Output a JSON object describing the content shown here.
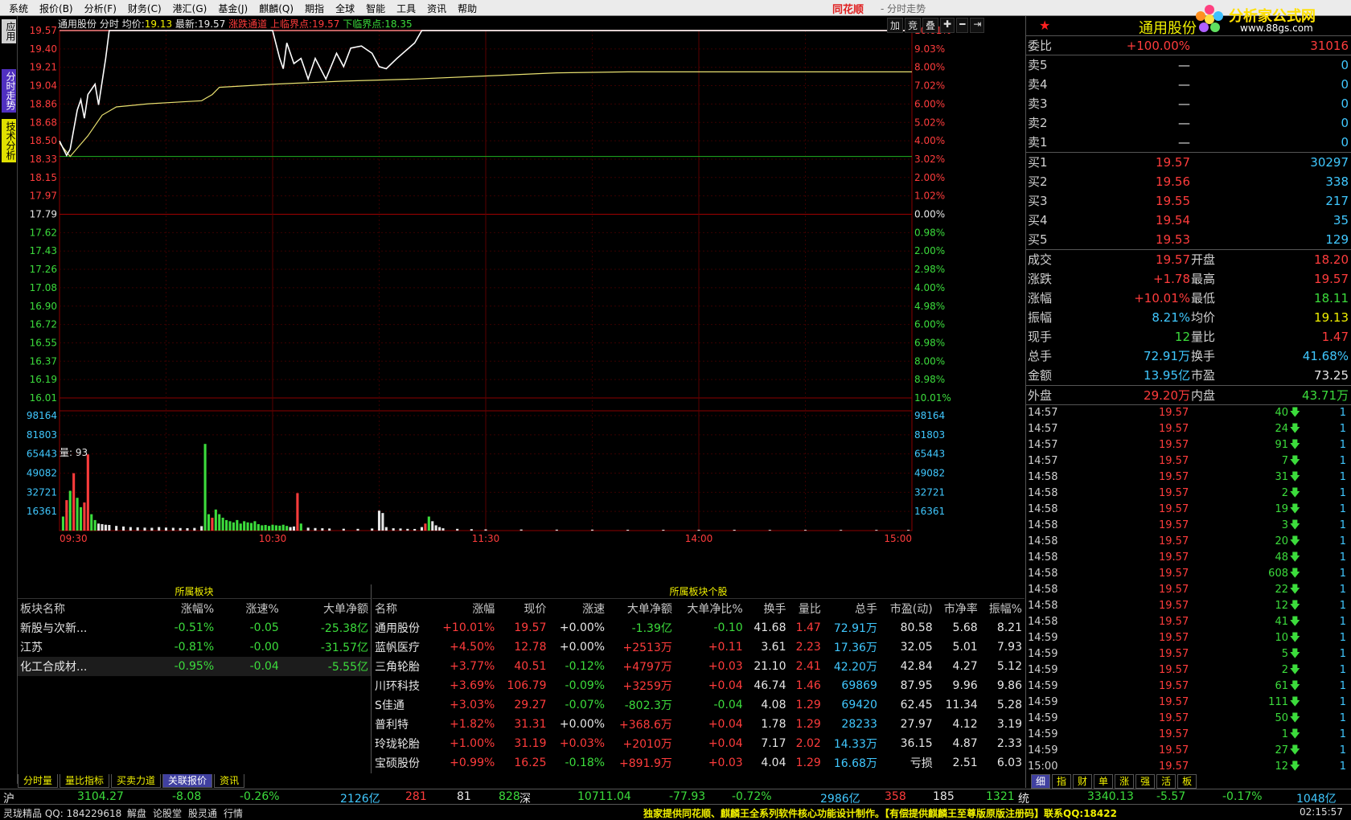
{
  "menu": [
    "系统",
    "报价(B)",
    "分析(F)",
    "财务(C)",
    "港汇(G)",
    "基金(J)",
    "麒麟(Q)",
    "期指",
    "全球",
    "智能",
    "工具",
    "资讯",
    "帮助"
  ],
  "brand": "同花顺",
  "window_title": "- 分时走势",
  "leftbar": {
    "app": "应用",
    "fenshi": "分时走势",
    "jishu": "技术分析"
  },
  "chart_header": {
    "stock": "通用股份",
    "mode": "分时",
    "avg_label": "均价:",
    "avg": "19.13",
    "latest_label": "最新:",
    "latest": "19.57",
    "channel_label": "涨跌通道",
    "upper_label": "上临界点:",
    "upper": "19.57",
    "lower_label": "下临界点:",
    "lower": "18.35"
  },
  "toolbar": [
    "加",
    "竞",
    "叠",
    "✚",
    "━",
    "⇥"
  ],
  "chart_data": {
    "type": "line",
    "price_axis": {
      "left_labels": [
        "19.57",
        "19.40",
        "19.21",
        "19.04",
        "18.86",
        "18.68",
        "18.50",
        "18.33",
        "18.15",
        "17.97",
        "17.79",
        "17.62",
        "17.43",
        "17.26",
        "17.08",
        "16.90",
        "16.72",
        "16.55",
        "16.37",
        "16.19",
        "16.01"
      ],
      "right_labels": [
        "10.01%",
        "9.03%",
        "8.00%",
        "7.02%",
        "6.00%",
        "5.02%",
        "4.00%",
        "3.02%",
        "2.00%",
        "1.02%",
        "0.00%",
        "0.98%",
        "2.00%",
        "2.98%",
        "4.00%",
        "4.98%",
        "6.00%",
        "6.98%",
        "8.00%",
        "8.98%",
        "10.01%"
      ],
      "ylim": [
        16.01,
        19.57
      ],
      "prev_close": 17.79
    },
    "time_labels": [
      "09:30",
      "10:30",
      "11:30",
      "14:00",
      "15:00"
    ],
    "price_series": [
      [
        0,
        18.5
      ],
      [
        2,
        18.36
      ],
      [
        3,
        18.42
      ],
      [
        5,
        18.8
      ],
      [
        6,
        18.9
      ],
      [
        7,
        18.72
      ],
      [
        8,
        18.95
      ],
      [
        10,
        19.05
      ],
      [
        11,
        18.85
      ],
      [
        13,
        19.3
      ],
      [
        14,
        19.57
      ],
      [
        60,
        19.57
      ],
      [
        62,
        19.3
      ],
      [
        63,
        19.2
      ],
      [
        64,
        19.45
      ],
      [
        66,
        19.25
      ],
      [
        68,
        19.3
      ],
      [
        70,
        19.1
      ],
      [
        72,
        19.3
      ],
      [
        75,
        19.1
      ],
      [
        78,
        19.35
      ],
      [
        80,
        19.22
      ],
      [
        82,
        19.4
      ],
      [
        85,
        19.42
      ],
      [
        88,
        19.35
      ],
      [
        90,
        19.22
      ],
      [
        92,
        19.2
      ],
      [
        95,
        19.3
      ],
      [
        100,
        19.45
      ],
      [
        102,
        19.57
      ],
      [
        240,
        19.57
      ]
    ],
    "avg_series": [
      [
        0,
        18.48
      ],
      [
        3,
        18.35
      ],
      [
        8,
        18.55
      ],
      [
        12,
        18.75
      ],
      [
        16,
        18.83
      ],
      [
        25,
        18.86
      ],
      [
        35,
        18.88
      ],
      [
        40,
        18.89
      ],
      [
        43,
        18.95
      ],
      [
        45,
        19.02
      ],
      [
        60,
        19.05
      ],
      [
        80,
        19.08
      ],
      [
        100,
        19.1
      ],
      [
        120,
        19.13
      ],
      [
        140,
        19.16
      ],
      [
        160,
        19.17
      ],
      [
        240,
        19.17
      ]
    ],
    "lower_line": 18.35,
    "volume": {
      "label": "量: 93",
      "axis_labels": [
        "98164",
        "81803",
        "65443",
        "49082",
        "32721",
        "16361"
      ],
      "ylim": [
        0,
        98164
      ],
      "bars": [
        [
          1,
          12000,
          "g"
        ],
        [
          2,
          26000,
          "r"
        ],
        [
          3,
          34000,
          "g"
        ],
        [
          4,
          49000,
          "r"
        ],
        [
          5,
          28000,
          "g"
        ],
        [
          6,
          20000,
          "g"
        ],
        [
          7,
          24000,
          "r"
        ],
        [
          8,
          65000,
          "r"
        ],
        [
          9,
          14000,
          "g"
        ],
        [
          10,
          9000,
          "g"
        ],
        [
          11,
          6000,
          "w"
        ],
        [
          12,
          5500,
          "w"
        ],
        [
          13,
          5000,
          "w"
        ],
        [
          14,
          4800,
          "w"
        ],
        [
          16,
          4000,
          "w"
        ],
        [
          18,
          3500,
          "w"
        ],
        [
          20,
          3000,
          "w"
        ],
        [
          22,
          2800,
          "w"
        ],
        [
          24,
          2500,
          "w"
        ],
        [
          26,
          2400,
          "w"
        ],
        [
          28,
          3000,
          "w"
        ],
        [
          30,
          2600,
          "w"
        ],
        [
          32,
          2400,
          "w"
        ],
        [
          34,
          2200,
          "w"
        ],
        [
          36,
          2100,
          "w"
        ],
        [
          38,
          2300,
          "w"
        ],
        [
          40,
          3800,
          "w"
        ],
        [
          41,
          74000,
          "g"
        ],
        [
          42,
          14000,
          "g"
        ],
        [
          43,
          11000,
          "r"
        ],
        [
          44,
          18000,
          "g"
        ],
        [
          45,
          14000,
          "g"
        ],
        [
          46,
          11000,
          "g"
        ],
        [
          47,
          9000,
          "g"
        ],
        [
          48,
          8000,
          "g"
        ],
        [
          49,
          7000,
          "g"
        ],
        [
          50,
          9000,
          "g"
        ],
        [
          51,
          6000,
          "g"
        ],
        [
          52,
          8000,
          "g"
        ],
        [
          53,
          7000,
          "g"
        ],
        [
          54,
          6500,
          "g"
        ],
        [
          55,
          8000,
          "g"
        ],
        [
          56,
          5500,
          "g"
        ],
        [
          57,
          4500,
          "g"
        ],
        [
          58,
          4800,
          "g"
        ],
        [
          59,
          4000,
          "g"
        ],
        [
          60,
          5000,
          "g"
        ],
        [
          61,
          4500,
          "g"
        ],
        [
          62,
          4200,
          "g"
        ],
        [
          63,
          5000,
          "g"
        ],
        [
          64,
          4000,
          "g"
        ],
        [
          65,
          3000,
          "w"
        ],
        [
          66,
          3500,
          "w"
        ],
        [
          67,
          32000,
          "r"
        ],
        [
          68,
          6000,
          "g"
        ],
        [
          70,
          2500,
          "w"
        ],
        [
          72,
          2200,
          "w"
        ],
        [
          74,
          2000,
          "w"
        ],
        [
          76,
          1800,
          "w"
        ],
        [
          80,
          1600,
          "w"
        ],
        [
          84,
          1500,
          "w"
        ],
        [
          88,
          1800,
          "w"
        ],
        [
          90,
          17000,
          "w"
        ],
        [
          91,
          15000,
          "w"
        ],
        [
          92,
          3000,
          "w"
        ],
        [
          94,
          2000,
          "w"
        ],
        [
          96,
          1800,
          "w"
        ],
        [
          98,
          1500,
          "w"
        ],
        [
          100,
          1400,
          "w"
        ],
        [
          102,
          3000,
          "w"
        ],
        [
          103,
          6000,
          "r"
        ],
        [
          104,
          12000,
          "g"
        ],
        [
          105,
          8000,
          "w"
        ],
        [
          106,
          4500,
          "w"
        ],
        [
          107,
          3000,
          "w"
        ],
        [
          108,
          2000,
          "w"
        ],
        [
          112,
          1500,
          "w"
        ],
        [
          116,
          1200,
          "w"
        ],
        [
          120,
          1000,
          "w"
        ],
        [
          130,
          900,
          "w"
        ],
        [
          140,
          800,
          "w"
        ],
        [
          150,
          800,
          "w"
        ],
        [
          160,
          700,
          "w"
        ],
        [
          170,
          700,
          "w"
        ],
        [
          180,
          700,
          "w"
        ],
        [
          190,
          700,
          "w"
        ],
        [
          200,
          600,
          "w"
        ],
        [
          210,
          600,
          "w"
        ],
        [
          220,
          600,
          "w"
        ],
        [
          230,
          600,
          "w"
        ],
        [
          239,
          600,
          "w"
        ]
      ]
    }
  },
  "sector": {
    "title": "所属板块",
    "headers": [
      "板块名称",
      "涨幅%",
      "涨速%",
      "大单净额"
    ],
    "rows": [
      [
        "新股与次新...",
        "-0.51%",
        "-0.05",
        "-25.38亿"
      ],
      [
        "江苏",
        "-0.81%",
        "-0.00",
        "-31.57亿"
      ],
      [
        "化工合成材...",
        "-0.95%",
        "-0.04",
        "-5.55亿"
      ]
    ]
  },
  "stocks": {
    "title": "所属板块个股",
    "headers": [
      "名称",
      "涨幅",
      "现价",
      "涨速",
      "大单净额",
      "大单净比%",
      "换手",
      "量比",
      "总手",
      "市盈(动)",
      "市净率",
      "振幅%"
    ],
    "rows": [
      [
        "通用股份",
        "+10.01%",
        "19.57",
        "+0.00%",
        "-1.39亿",
        "-0.10",
        "41.68",
        "1.47",
        "72.91万",
        "80.58",
        "5.68",
        "8.21"
      ],
      [
        "蓝帆医疗",
        "+4.50%",
        "12.78",
        "+0.00%",
        "+2513万",
        "+0.11",
        "3.61",
        "2.23",
        "17.36万",
        "32.05",
        "5.01",
        "7.93"
      ],
      [
        "三角轮胎",
        "+3.77%",
        "40.51",
        "-0.12%",
        "+4797万",
        "+0.03",
        "21.10",
        "2.41",
        "42.20万",
        "42.84",
        "4.27",
        "5.12"
      ],
      [
        "川环科技",
        "+3.69%",
        "106.79",
        "-0.09%",
        "+3259万",
        "+0.04",
        "46.74",
        "1.46",
        "69869",
        "87.95",
        "9.96",
        "9.86"
      ],
      [
        "S佳通",
        "+3.03%",
        "29.27",
        "-0.07%",
        "-802.3万",
        "-0.04",
        "4.08",
        "1.29",
        "69420",
        "62.45",
        "11.34",
        "5.28"
      ],
      [
        "普利特",
        "+1.82%",
        "31.31",
        "+0.00%",
        "+368.6万",
        "+0.04",
        "1.78",
        "1.29",
        "28233",
        "27.97",
        "4.12",
        "3.19"
      ],
      [
        "玲珑轮胎",
        "+1.00%",
        "31.19",
        "+0.03%",
        "+2010万",
        "+0.04",
        "7.17",
        "2.02",
        "14.33万",
        "36.15",
        "4.87",
        "2.33"
      ],
      [
        "宝硕股份",
        "+0.99%",
        "16.25",
        "-0.18%",
        "+891.9万",
        "+0.03",
        "4.04",
        "1.29",
        "16.68万",
        "亏损",
        "2.51",
        "6.03"
      ]
    ]
  },
  "tabs": [
    "分时量",
    "量比指标",
    "买卖力道",
    "关联报价",
    "资讯"
  ],
  "quote": {
    "name": "通用股份",
    "weibi_label": "委比",
    "weibi": "+100.00%",
    "weicha": "31016",
    "sell": [
      [
        "卖5",
        "—",
        "0"
      ],
      [
        "卖4",
        "—",
        "0"
      ],
      [
        "卖3",
        "—",
        "0"
      ],
      [
        "卖2",
        "—",
        "0"
      ],
      [
        "卖1",
        "—",
        "0"
      ]
    ],
    "buy": [
      [
        "买1",
        "19.57",
        "30297"
      ],
      [
        "买2",
        "19.56",
        "338"
      ],
      [
        "买3",
        "19.55",
        "217"
      ],
      [
        "买4",
        "19.54",
        "35"
      ],
      [
        "买5",
        "19.53",
        "129"
      ]
    ],
    "stats": [
      [
        "成交",
        "19.57",
        "开盘",
        "18.20"
      ],
      [
        "涨跌",
        "+1.78",
        "最高",
        "19.57"
      ],
      [
        "涨幅",
        "+10.01%",
        "最低",
        "18.11"
      ],
      [
        "振幅",
        "8.21%",
        "均价",
        "19.13"
      ],
      [
        "现手",
        "12",
        "量比",
        "1.47"
      ],
      [
        "总手",
        "72.91万",
        "换手",
        "41.68%"
      ],
      [
        "金额",
        "13.95亿",
        "市盈",
        "73.25"
      ]
    ],
    "outer_label": "外盘",
    "outer": "29.20万",
    "inner_label": "内盘",
    "inner": "43.71万"
  },
  "ticks": [
    [
      "14:57",
      "19.57",
      "40",
      "1"
    ],
    [
      "14:57",
      "19.57",
      "24",
      "1"
    ],
    [
      "14:57",
      "19.57",
      "91",
      "1"
    ],
    [
      "14:57",
      "19.57",
      "7",
      "1"
    ],
    [
      "14:58",
      "19.57",
      "31",
      "1"
    ],
    [
      "14:58",
      "19.57",
      "2",
      "1"
    ],
    [
      "14:58",
      "19.57",
      "19",
      "1"
    ],
    [
      "14:58",
      "19.57",
      "3",
      "1"
    ],
    [
      "14:58",
      "19.57",
      "20",
      "1"
    ],
    [
      "14:58",
      "19.57",
      "48",
      "1"
    ],
    [
      "14:58",
      "19.57",
      "608",
      "1"
    ],
    [
      "14:58",
      "19.57",
      "22",
      "1"
    ],
    [
      "14:58",
      "19.57",
      "12",
      "1"
    ],
    [
      "14:58",
      "19.57",
      "41",
      "1"
    ],
    [
      "14:59",
      "19.57",
      "10",
      "1"
    ],
    [
      "14:59",
      "19.57",
      "5",
      "1"
    ],
    [
      "14:59",
      "19.57",
      "2",
      "1"
    ],
    [
      "14:59",
      "19.57",
      "61",
      "1"
    ],
    [
      "14:59",
      "19.57",
      "111",
      "1"
    ],
    [
      "14:59",
      "19.57",
      "50",
      "1"
    ],
    [
      "14:59",
      "19.57",
      "1",
      "1"
    ],
    [
      "14:59",
      "19.57",
      "27",
      "1"
    ],
    [
      "15:00",
      "19.57",
      "12",
      "1"
    ]
  ],
  "rtabs": [
    "细",
    "指",
    "财",
    "单",
    "涨",
    "强",
    "活",
    "板"
  ],
  "status": {
    "sh_label": "沪",
    "sh_idx": "3104.27",
    "sh_chg": "-8.08",
    "sh_pct": "-0.26%",
    "sh_amt": "2126亿",
    "sh_up": "281",
    "sh_flat": "81",
    "sh_down": "828",
    "sz_label": "深",
    "sz_idx": "10711.04",
    "sz_chg": "-77.93",
    "sz_pct": "-0.72%",
    "sz_amt": "2986亿",
    "sz_up": "358",
    "sz_flat": "185",
    "sz_down": "1321",
    "ty_label": "统",
    "ty_idx": "3340.13",
    "ty_chg": "-5.57",
    "ty_pct": "-0.17%",
    "ty_amt": "1048亿"
  },
  "bottombar": {
    "app": "灵珑精品 QQ: 184229618",
    "links": [
      "解盘",
      "论股堂",
      "股灵通",
      "行情"
    ],
    "marquee": "独家提供同花顺、麒麟王全系列软件核心功能设计制作。【有偿提供麒麟王至尊版原版注册码】联系QQ:18422",
    "time": "02:15:57"
  },
  "logo": {
    "text": "分析家公式网",
    "url": "www.88gs.com"
  }
}
